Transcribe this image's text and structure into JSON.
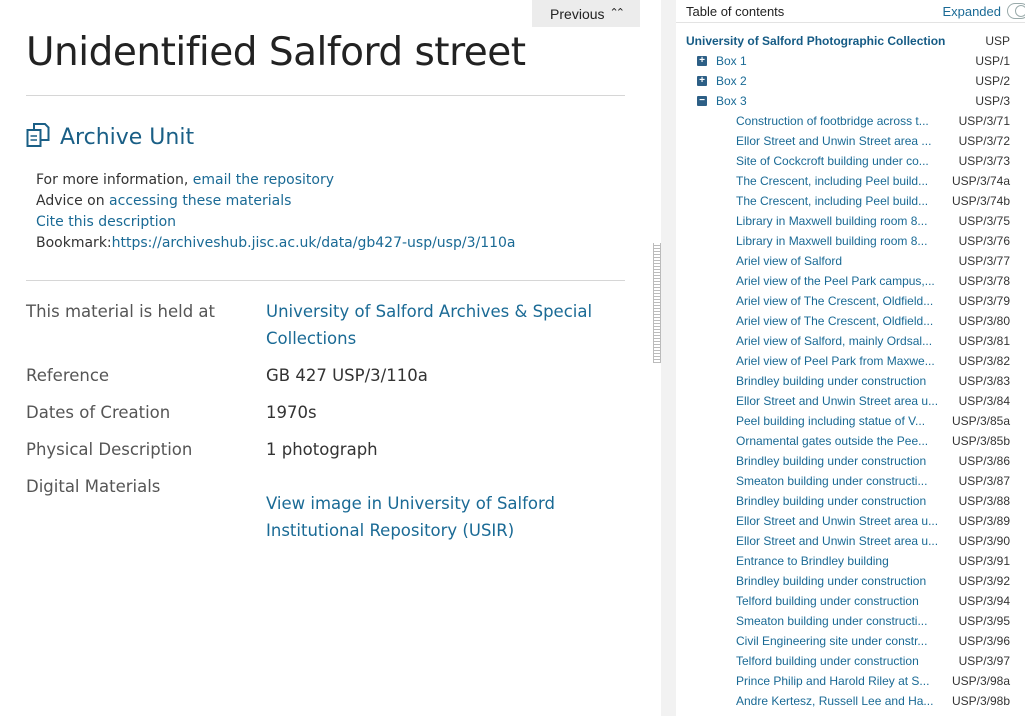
{
  "previous": {
    "label": "Previous",
    "chevron": "«"
  },
  "page_title": "Unidentified Salford street",
  "unit_heading": "Archive Unit",
  "info": {
    "more_prefix": "For more information,",
    "more_link": "email the repository",
    "advice_prefix": "Advice on",
    "advice_link": "accessing these materials",
    "cite_link": "Cite this description",
    "bookmark_prefix": "Bookmark:",
    "bookmark_url": "https://archiveshub.jisc.ac.uk/data/gb427-usp/usp/3/110a"
  },
  "details": {
    "held_label": "This material is held at",
    "held_value": "University of Salford Archives & Special Collections",
    "reference_label": "Reference",
    "reference_value": "GB 427 USP/3/110a",
    "dates_label": "Dates of Creation",
    "dates_value": "1970s",
    "physical_label": "Physical Description",
    "physical_value": "1 photograph",
    "digital_label": "Digital Materials",
    "digital_link": "View image in University of Salford Institutional Repository (USIR)"
  },
  "toc": {
    "title": "Table of contents",
    "expanded_label": "Expanded",
    "root": {
      "title": "University of Salford Photographic Collection",
      "ref": "USP"
    },
    "boxes": [
      {
        "title": "Box 1",
        "ref": "USP/1",
        "sign": "+"
      },
      {
        "title": "Box 2",
        "ref": "USP/2",
        "sign": "+"
      },
      {
        "title": "Box 3",
        "ref": "USP/3",
        "sign": "−"
      }
    ],
    "items": [
      {
        "title": "Construction of footbridge across t...",
        "ref": "USP/3/71"
      },
      {
        "title": "Ellor Street and Unwin Street area ...",
        "ref": "USP/3/72"
      },
      {
        "title": "Site of Cockcroft building under co...",
        "ref": "USP/3/73"
      },
      {
        "title": "The Crescent, including Peel build...",
        "ref": "USP/3/74a"
      },
      {
        "title": "The Crescent, including Peel build...",
        "ref": "USP/3/74b"
      },
      {
        "title": "Library in Maxwell building room 8...",
        "ref": "USP/3/75"
      },
      {
        "title": "Library in Maxwell building room 8...",
        "ref": "USP/3/76"
      },
      {
        "title": "Ariel view of Salford",
        "ref": "USP/3/77"
      },
      {
        "title": "Ariel view of the Peel Park campus,...",
        "ref": "USP/3/78"
      },
      {
        "title": "Ariel view of The Crescent, Oldfield...",
        "ref": "USP/3/79"
      },
      {
        "title": "Ariel view of The Crescent, Oldfield...",
        "ref": "USP/3/80"
      },
      {
        "title": "Ariel view of Salford, mainly Ordsal...",
        "ref": "USP/3/81"
      },
      {
        "title": "Ariel view of Peel Park from Maxwe...",
        "ref": "USP/3/82"
      },
      {
        "title": "Brindley building under construction",
        "ref": "USP/3/83"
      },
      {
        "title": "Ellor Street and Unwin Street area u...",
        "ref": "USP/3/84"
      },
      {
        "title": "Peel building including statue of V...",
        "ref": "USP/3/85a"
      },
      {
        "title": "Ornamental gates outside the Pee...",
        "ref": "USP/3/85b"
      },
      {
        "title": "Brindley building under construction",
        "ref": "USP/3/86"
      },
      {
        "title": "Smeaton building under constructi...",
        "ref": "USP/3/87"
      },
      {
        "title": "Brindley building under construction",
        "ref": "USP/3/88"
      },
      {
        "title": "Ellor Street and Unwin Street area u...",
        "ref": "USP/3/89"
      },
      {
        "title": "Ellor Street and Unwin Street area u...",
        "ref": "USP/3/90"
      },
      {
        "title": "Entrance to Brindley building",
        "ref": "USP/3/91"
      },
      {
        "title": "Brindley building under construction",
        "ref": "USP/3/92"
      },
      {
        "title": "Telford building under construction",
        "ref": "USP/3/94"
      },
      {
        "title": "Smeaton building under constructi...",
        "ref": "USP/3/95"
      },
      {
        "title": "Civil Engineering site under constr...",
        "ref": "USP/3/96"
      },
      {
        "title": "Telford building under construction",
        "ref": "USP/3/97"
      },
      {
        "title": "Prince Philip and Harold Riley at S...",
        "ref": "USP/3/98a"
      },
      {
        "title": "Andre Kertesz, Russell Lee and Ha...",
        "ref": "USP/3/98b"
      }
    ]
  }
}
